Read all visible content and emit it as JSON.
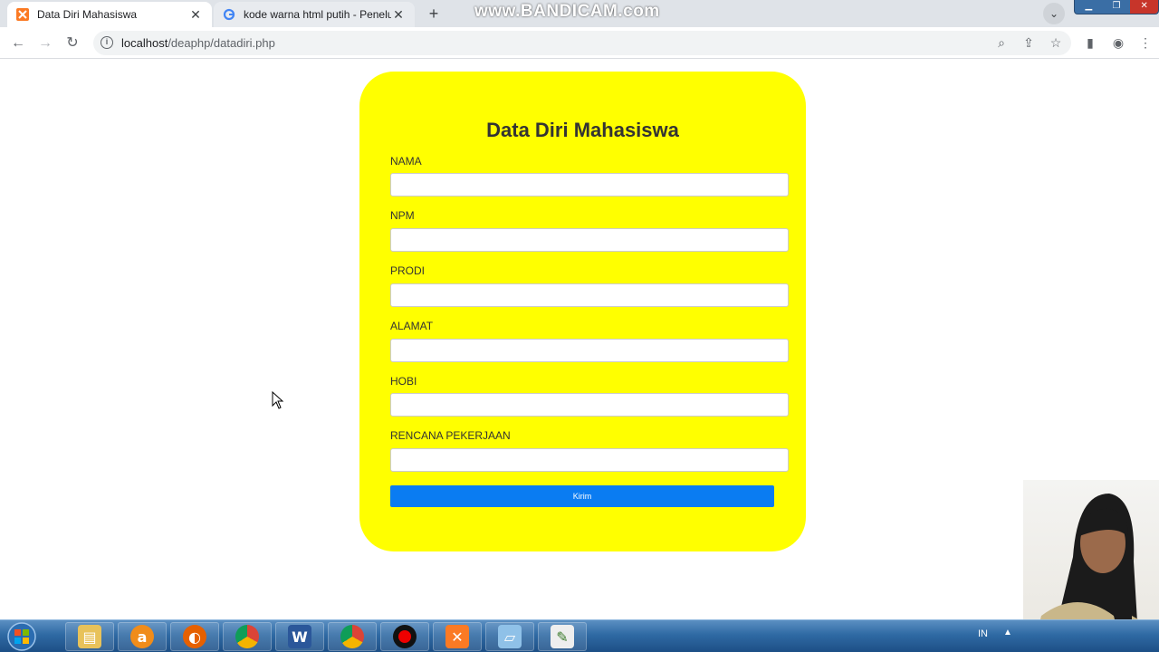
{
  "browser": {
    "tabs": [
      {
        "title": "Data Diri Mahasiswa",
        "active": true
      },
      {
        "title": "kode warna html putih - Penelusuran",
        "active": false
      }
    ],
    "url_host": "localhost",
    "url_path": "/deaphp/datadiri.php",
    "watermark": "www.BANDICAM.com"
  },
  "form": {
    "title": "Data Diri Mahasiswa",
    "fields": [
      {
        "label": "NAMA",
        "value": ""
      },
      {
        "label": "NPM",
        "value": ""
      },
      {
        "label": "PRODI",
        "value": ""
      },
      {
        "label": "ALAMAT",
        "value": ""
      },
      {
        "label": "HOBI",
        "value": ""
      },
      {
        "label": "RENCANA PEKERJAAN",
        "value": ""
      }
    ],
    "submit_label": "Kirim",
    "card_color": "#ffff00",
    "button_color": "#0a7cf2"
  },
  "taskbar": {
    "apps": [
      "explorer-icon",
      "avast-icon",
      "firefox-icon",
      "chrome-icon",
      "word-icon",
      "chrome-icon",
      "bandicam-record-icon",
      "xampp-icon",
      "notepad-icon",
      "editor-icon"
    ],
    "language": "IN"
  }
}
